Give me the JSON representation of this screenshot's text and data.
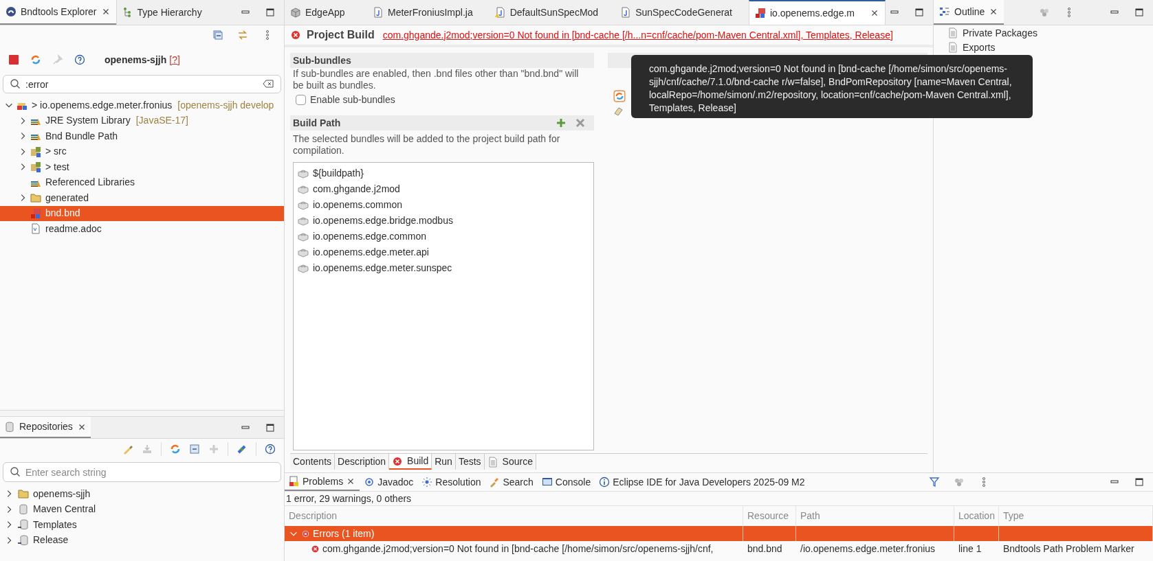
{
  "explorer": {
    "tabs": [
      {
        "label": "Bndtools Explorer",
        "selected": true,
        "kind": "bnd"
      },
      {
        "label": "Type Hierarchy",
        "selected": false,
        "kind": "hierarchy"
      }
    ],
    "workspace": {
      "name": "openems-sjjh",
      "badge": "[?]"
    },
    "filter": {
      "value": ":error"
    },
    "tree": [
      {
        "label": "> io.openems.edge.meter.fronius",
        "decoration": "[openems-sjjh develop",
        "kind": "project",
        "expanded": true,
        "selected": false,
        "children": [
          {
            "label": "JRE System Library",
            "decoration": "[JavaSE-17]",
            "kind": "library",
            "expanded": false,
            "selected": false
          },
          {
            "label": "Bnd Bundle Path",
            "kind": "library",
            "expanded": false,
            "selected": false
          },
          {
            "label": "> src",
            "kind": "source",
            "expanded": false,
            "selected": false
          },
          {
            "label": "> test",
            "kind": "source",
            "expanded": false,
            "selected": false
          },
          {
            "label": "Referenced Libraries",
            "kind": "library",
            "selected": false
          },
          {
            "label": "generated",
            "kind": "folder",
            "expanded": false,
            "selected": false
          },
          {
            "label": "bnd.bnd",
            "kind": "bndfile",
            "selected": true
          },
          {
            "label": "readme.adoc",
            "kind": "file",
            "selected": false
          }
        ]
      }
    ]
  },
  "repositories": {
    "tab": "Repositories",
    "search": {
      "placeholder": "Enter search string"
    },
    "items": [
      {
        "label": "openems-sjjh",
        "kind": "folder"
      },
      {
        "label": "Maven Central",
        "kind": "repo"
      },
      {
        "label": "Templates",
        "kind": "remote"
      },
      {
        "label": "Release",
        "kind": "remote"
      }
    ]
  },
  "editor": {
    "tabs": [
      {
        "label": "EdgeApp",
        "kind": "app",
        "selected": false
      },
      {
        "label": "MeterFroniusImpl.ja",
        "kind": "java",
        "selected": false
      },
      {
        "label": "DefaultSunSpecMod",
        "kind": "javawarn",
        "selected": false
      },
      {
        "label": "SunSpecCodeGenerat",
        "kind": "java",
        "selected": false
      },
      {
        "label": "io.openems.edge.m",
        "kind": "bndfile",
        "selected": true
      }
    ],
    "title": "Project Build",
    "error": "com.ghgande.j2mod;version=0 Not found in [bnd-cache [/h...n=cnf/cache/pom-Maven Central.xml], Templates, Release]",
    "sub_bundles": {
      "title": "Sub-bundles",
      "description": "If sub-bundles are enabled, then .bnd files other than \"bnd.bnd\" will be built as bundles.",
      "checkbox": {
        "label": "Enable sub-bundles",
        "checked": false
      }
    },
    "build_path": {
      "title": "Build Path",
      "description": "The selected bundles will be added to the project build path for compilation.",
      "bundles": [
        "${buildpath}",
        "com.ghgande.j2mod",
        "io.openems.common",
        "io.openems.edge.bridge.modbus",
        "io.openems.edge.common",
        "io.openems.edge.meter.api",
        "io.openems.edge.meter.sunspec"
      ]
    },
    "page_tabs": [
      {
        "label": "Contents",
        "selected": false
      },
      {
        "label": "Description",
        "selected": false
      },
      {
        "label": "Build",
        "selected": true,
        "kind": "error"
      },
      {
        "label": "Run",
        "selected": false
      },
      {
        "label": "Tests",
        "selected": false
      },
      {
        "label": "Source",
        "selected": false,
        "kind": "doc"
      }
    ],
    "tooltip": "com.ghgande.j2mod;version=0 Not found in [bnd-cache [/home/simon/src/openems-sjjh/cnf/cache/7.1.0/bnd-cache r/w=false], BndPomRepository [name=Maven Central, localRepo=/home/simon/.m2/repository, location=cnf/cache/pom-Maven Central.xml], Templates, Release]"
  },
  "outline": {
    "tab": "Outline",
    "items": [
      "Private Packages",
      "Exports"
    ]
  },
  "problems": {
    "tabs": [
      {
        "label": "Problems",
        "kind": "problems",
        "selected": true
      },
      {
        "label": "Javadoc",
        "kind": "javadoc",
        "selected": false
      },
      {
        "label": "Resolution",
        "kind": "resolution",
        "selected": false
      },
      {
        "label": "Search",
        "kind": "search",
        "selected": false
      },
      {
        "label": "Console",
        "kind": "console",
        "selected": false
      },
      {
        "label": "Eclipse IDE for Java Developers 2025-09 M2",
        "kind": "info",
        "selected": false
      }
    ],
    "summary": "1 error, 29 warnings, 0 others",
    "columns": [
      "Description",
      "Resource",
      "Path",
      "Location",
      "Type"
    ],
    "groups": [
      {
        "label": "Errors (1 item)",
        "expanded": true,
        "selected": true,
        "rows": [
          [
            "com.ghgande.j2mod;version=0 Not found in [bnd-cache [/home/simon/src/openems-sjjh/cnf,",
            "bnd.bnd",
            "/io.openems.edge.meter.fronius",
            "line 1",
            "Bndtools Path Problem Marker"
          ]
        ]
      }
    ]
  }
}
